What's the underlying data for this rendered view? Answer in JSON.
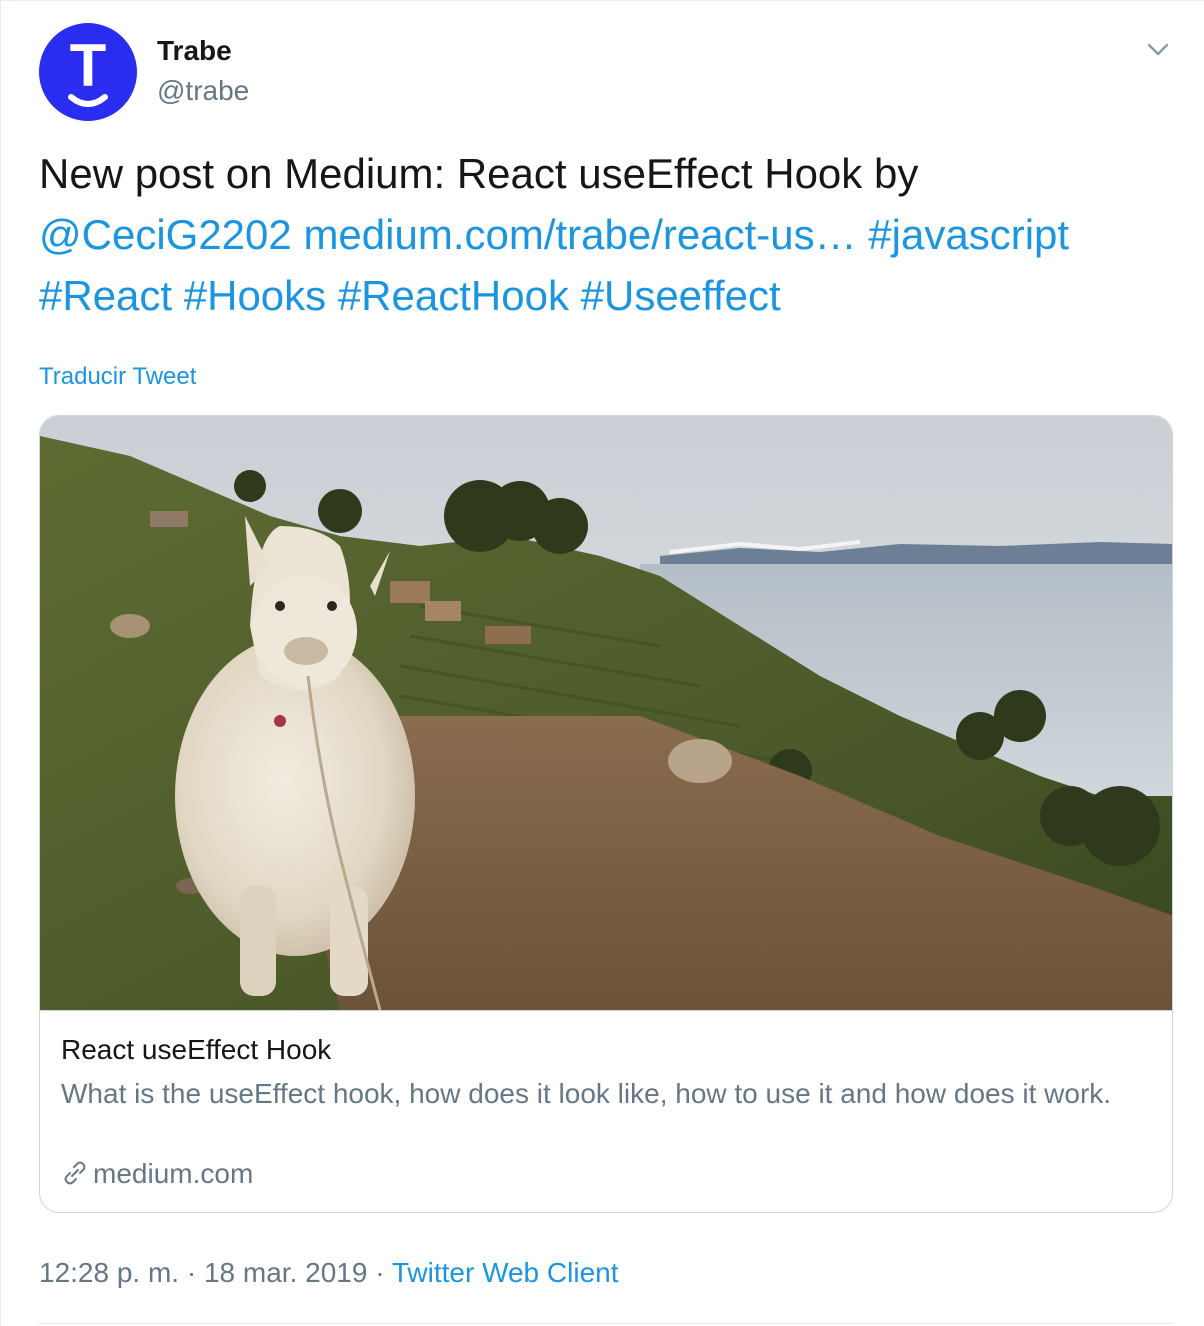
{
  "user": {
    "name": "Trabe",
    "handle": "@trabe",
    "avatar_letter": "T",
    "avatar_color": "#2a2cef"
  },
  "tweet": {
    "text_plain": "New post on Medium: React useEffect Hook by",
    "mention": "@CeciG2202",
    "url": "medium.com/trabe/react-us…",
    "hashtags": [
      "#javascript",
      "#React",
      "#Hooks",
      "#ReactHook",
      "#Useeffect"
    ]
  },
  "translate_label": "Traducir Tweet",
  "card": {
    "title": "React useEffect Hook",
    "description": "What is the useEffect hook, how does it look like, how to use it and how does it work.",
    "domain": "medium.com",
    "icon": "link-icon"
  },
  "meta": {
    "time": "12:28 p. m.",
    "separator": "·",
    "date": "18 mar. 2019",
    "source": "Twitter Web Client"
  },
  "colors": {
    "link": "#1b95e0",
    "text": "#14171a",
    "secondary": "#657786",
    "border": "#ccd6dd"
  }
}
